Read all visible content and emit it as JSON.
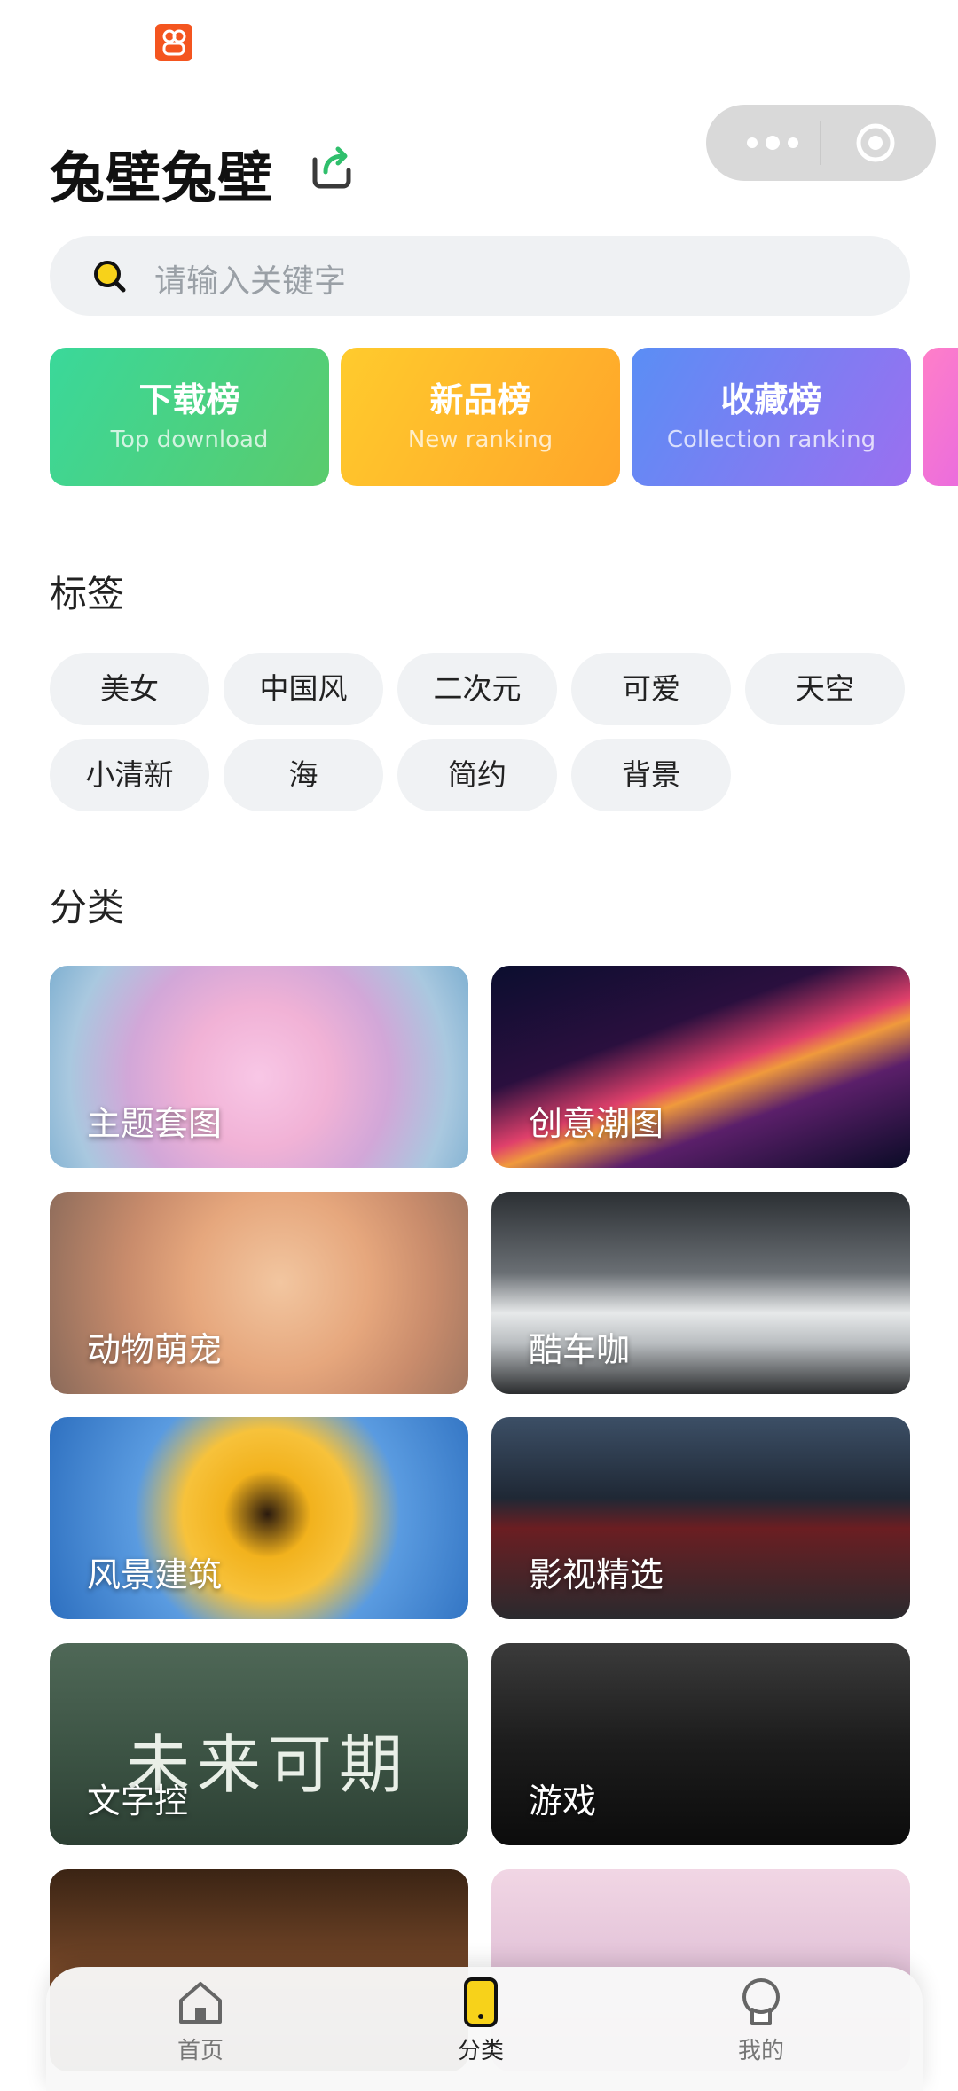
{
  "header": {
    "title": "兔壁兔壁"
  },
  "search": {
    "placeholder": "请输入关键字"
  },
  "rankings": [
    {
      "title": "下载榜",
      "subtitle": "Top download"
    },
    {
      "title": "新品榜",
      "subtitle": "New ranking"
    },
    {
      "title": "收藏榜",
      "subtitle": "Collection ranking"
    }
  ],
  "tags_section": {
    "title": "标签",
    "tags": [
      "美女",
      "中国风",
      "二次元",
      "可爱",
      "天空",
      "小清新",
      "海",
      "简约",
      "背景"
    ]
  },
  "categories_section": {
    "title": "分类",
    "items": [
      {
        "label": "主题套图"
      },
      {
        "label": "创意潮图"
      },
      {
        "label": "动物萌宠"
      },
      {
        "label": "酷车咖"
      },
      {
        "label": "风景建筑"
      },
      {
        "label": "影视精选"
      },
      {
        "label": "文字控",
        "image_text": "未来可期"
      },
      {
        "label": "游戏"
      },
      {
        "label": ""
      },
      {
        "label": ""
      }
    ]
  },
  "tabbar": {
    "items": [
      {
        "label": "首页",
        "icon": "home-icon"
      },
      {
        "label": "分类",
        "icon": "category-icon",
        "active": true
      },
      {
        "label": "我的",
        "icon": "profile-icon"
      }
    ]
  },
  "colors": {
    "accent": "#f7d21a",
    "status_icon": "#f4551f"
  }
}
